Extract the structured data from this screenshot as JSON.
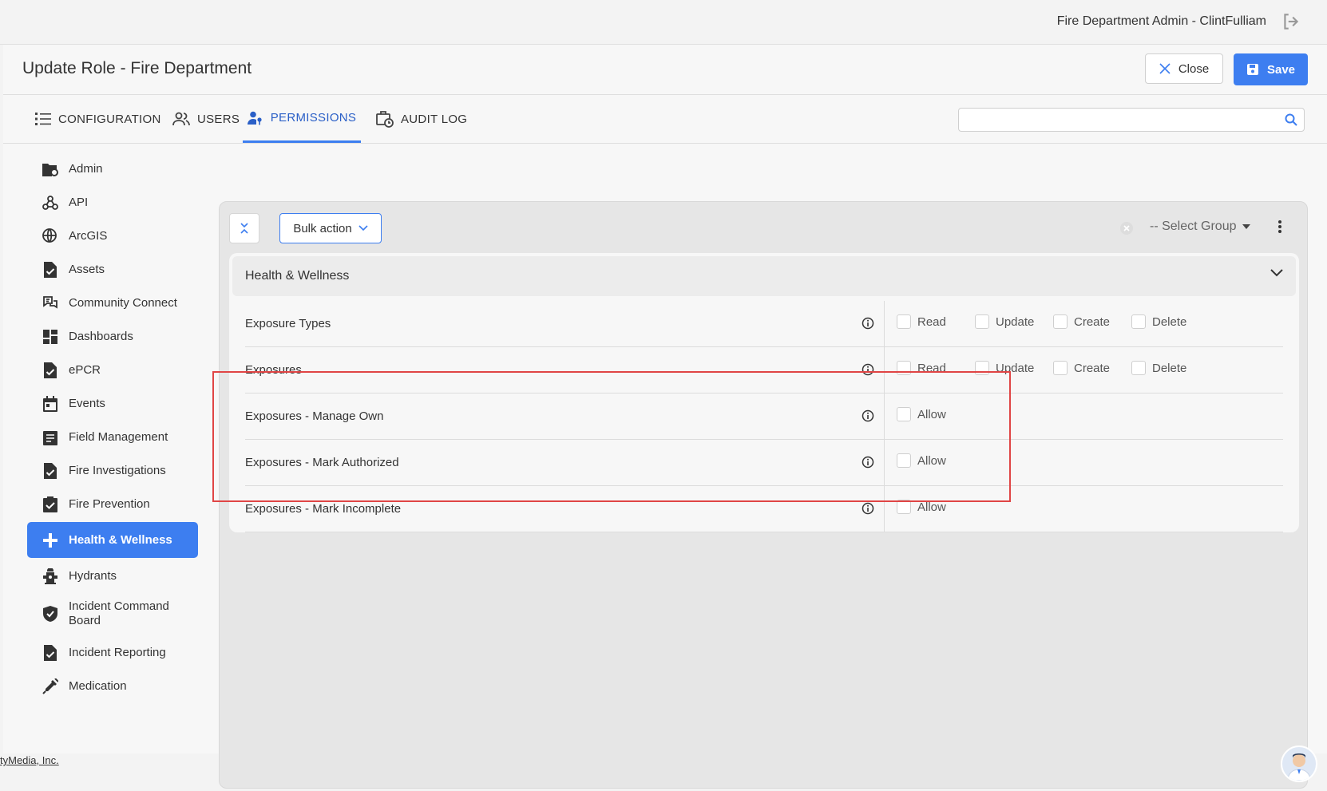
{
  "topbar": {
    "user_label": "Fire Department Admin - ClintFulliam"
  },
  "header": {
    "title": "Update Role - Fire Department",
    "close_label": "Close",
    "save_label": "Save"
  },
  "tabs": [
    {
      "label": "CONFIGURATION"
    },
    {
      "label": "USERS"
    },
    {
      "label": "PERMISSIONS"
    },
    {
      "label": "AUDIT LOG"
    }
  ],
  "search": {
    "value": "",
    "placeholder": ""
  },
  "sidebar": {
    "items": [
      {
        "label": "Admin"
      },
      {
        "label": "API"
      },
      {
        "label": "ArcGIS"
      },
      {
        "label": "Assets"
      },
      {
        "label": "Community Connect"
      },
      {
        "label": "Dashboards"
      },
      {
        "label": "ePCR"
      },
      {
        "label": "Events"
      },
      {
        "label": "Field Management"
      },
      {
        "label": "Fire Investigations"
      },
      {
        "label": "Fire Prevention"
      },
      {
        "label": "Health & Wellness"
      },
      {
        "label": "Hydrants"
      },
      {
        "label": "Incident Command Board"
      },
      {
        "label": "Incident Reporting"
      },
      {
        "label": "Medication"
      }
    ]
  },
  "toolbar": {
    "bulk_label": "Bulk action",
    "group_placeholder": "-- Select Group"
  },
  "section": {
    "title": "Health & Wellness",
    "rows": [
      {
        "name": "Exposure Types",
        "perms": [
          "Read",
          "Update",
          "Create",
          "Delete"
        ]
      },
      {
        "name": "Exposures",
        "perms": [
          "Read",
          "Update",
          "Create",
          "Delete"
        ]
      },
      {
        "name": "Exposures - Manage Own",
        "perms": [
          "Allow"
        ]
      },
      {
        "name": "Exposures - Mark Authorized",
        "perms": [
          "Allow"
        ]
      },
      {
        "name": "Exposures - Mark Incomplete",
        "perms": [
          "Allow"
        ]
      }
    ]
  },
  "footer": {
    "text": "tyMedia, Inc."
  },
  "colors": {
    "accent": "#3d7ef0",
    "highlight": "#e04545"
  }
}
